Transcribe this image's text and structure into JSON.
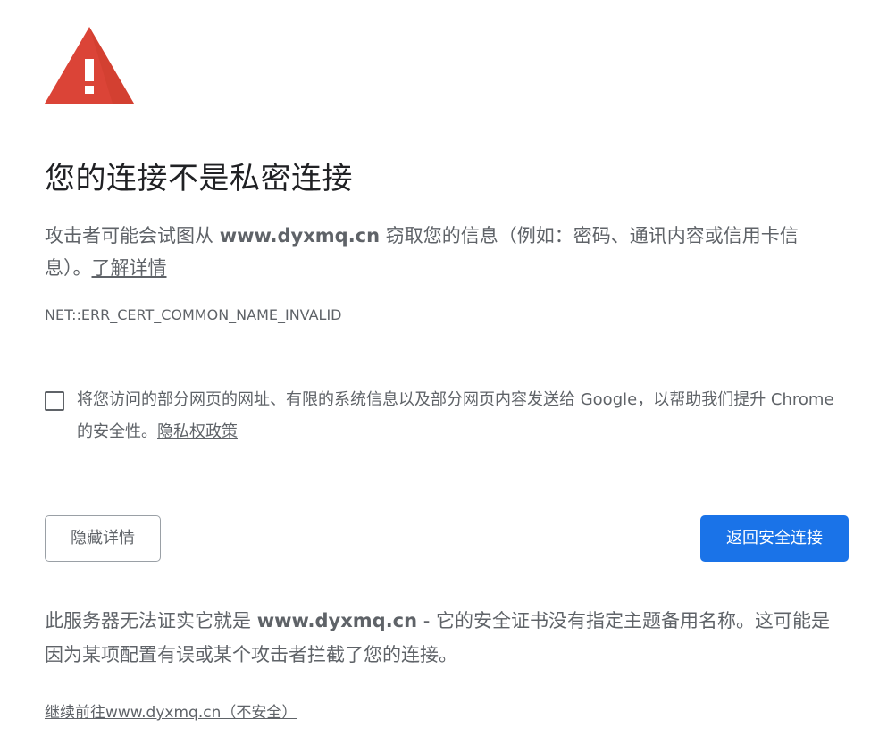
{
  "icon": {
    "name": "warning-triangle-icon",
    "color": "#db4437",
    "glyph": "!"
  },
  "heading": "您的连接不是私密连接",
  "intro": {
    "before": "攻击者可能会试图从 ",
    "domain": "www.dyxmq.cn",
    "after": " 窃取您的信息（例如：密码、通讯内容或信用卡信息）。",
    "learn_more": "了解详情"
  },
  "error_code": "NET::ERR_CERT_COMMON_NAME_INVALID",
  "optin": {
    "checked": false,
    "text": "将您访问的部分网页的网址、有限的系统信息以及部分网页内容发送给 Google，以帮助我们提升 Chrome 的安全性。",
    "privacy_link": "隐私权政策"
  },
  "buttons": {
    "hide_details": "隐藏详情",
    "back_to_safety": "返回安全连接"
  },
  "explanation": {
    "before": "此服务器无法证实它就是 ",
    "domain": "www.dyxmq.cn",
    "after": " - 它的安全证书没有指定主题备用名称。这可能是因为某项配置有误或某个攻击者拦截了您的连接。"
  },
  "proceed_link": "继续前往www.dyxmq.cn（不安全）",
  "colors": {
    "primary_button": "#1a73e8",
    "text_secondary": "#5f6368",
    "text_primary": "#202124",
    "danger": "#db4437"
  }
}
